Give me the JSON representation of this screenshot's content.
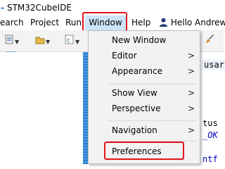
{
  "titlebar": {
    "prefix": "-",
    "title": "STM32CubeIDE"
  },
  "menubar": {
    "items": [
      "earch",
      "Project",
      "Run",
      "Window",
      "Help"
    ],
    "user_label": "Hello Andrew"
  },
  "editor": {
    "tab_fragment": "usar",
    "code_lines": [
      "tus",
      "_OK",
      "ntf"
    ]
  },
  "window_menu": {
    "items": [
      {
        "label": "New Window",
        "submenu": false
      },
      {
        "label": "Editor",
        "submenu": true
      },
      {
        "label": "Appearance",
        "submenu": true
      },
      {
        "label": "Show View",
        "submenu": true
      },
      {
        "label": "Perspective",
        "submenu": true
      },
      {
        "label": "Navigation",
        "submenu": true
      },
      {
        "label": "Preferences",
        "submenu": false
      }
    ],
    "submenu_glyph": ">"
  },
  "colors": {
    "highlight": "#e0141b",
    "menu_bg": "#f2f2f2",
    "active_menu_bg": "#cce4f7"
  }
}
